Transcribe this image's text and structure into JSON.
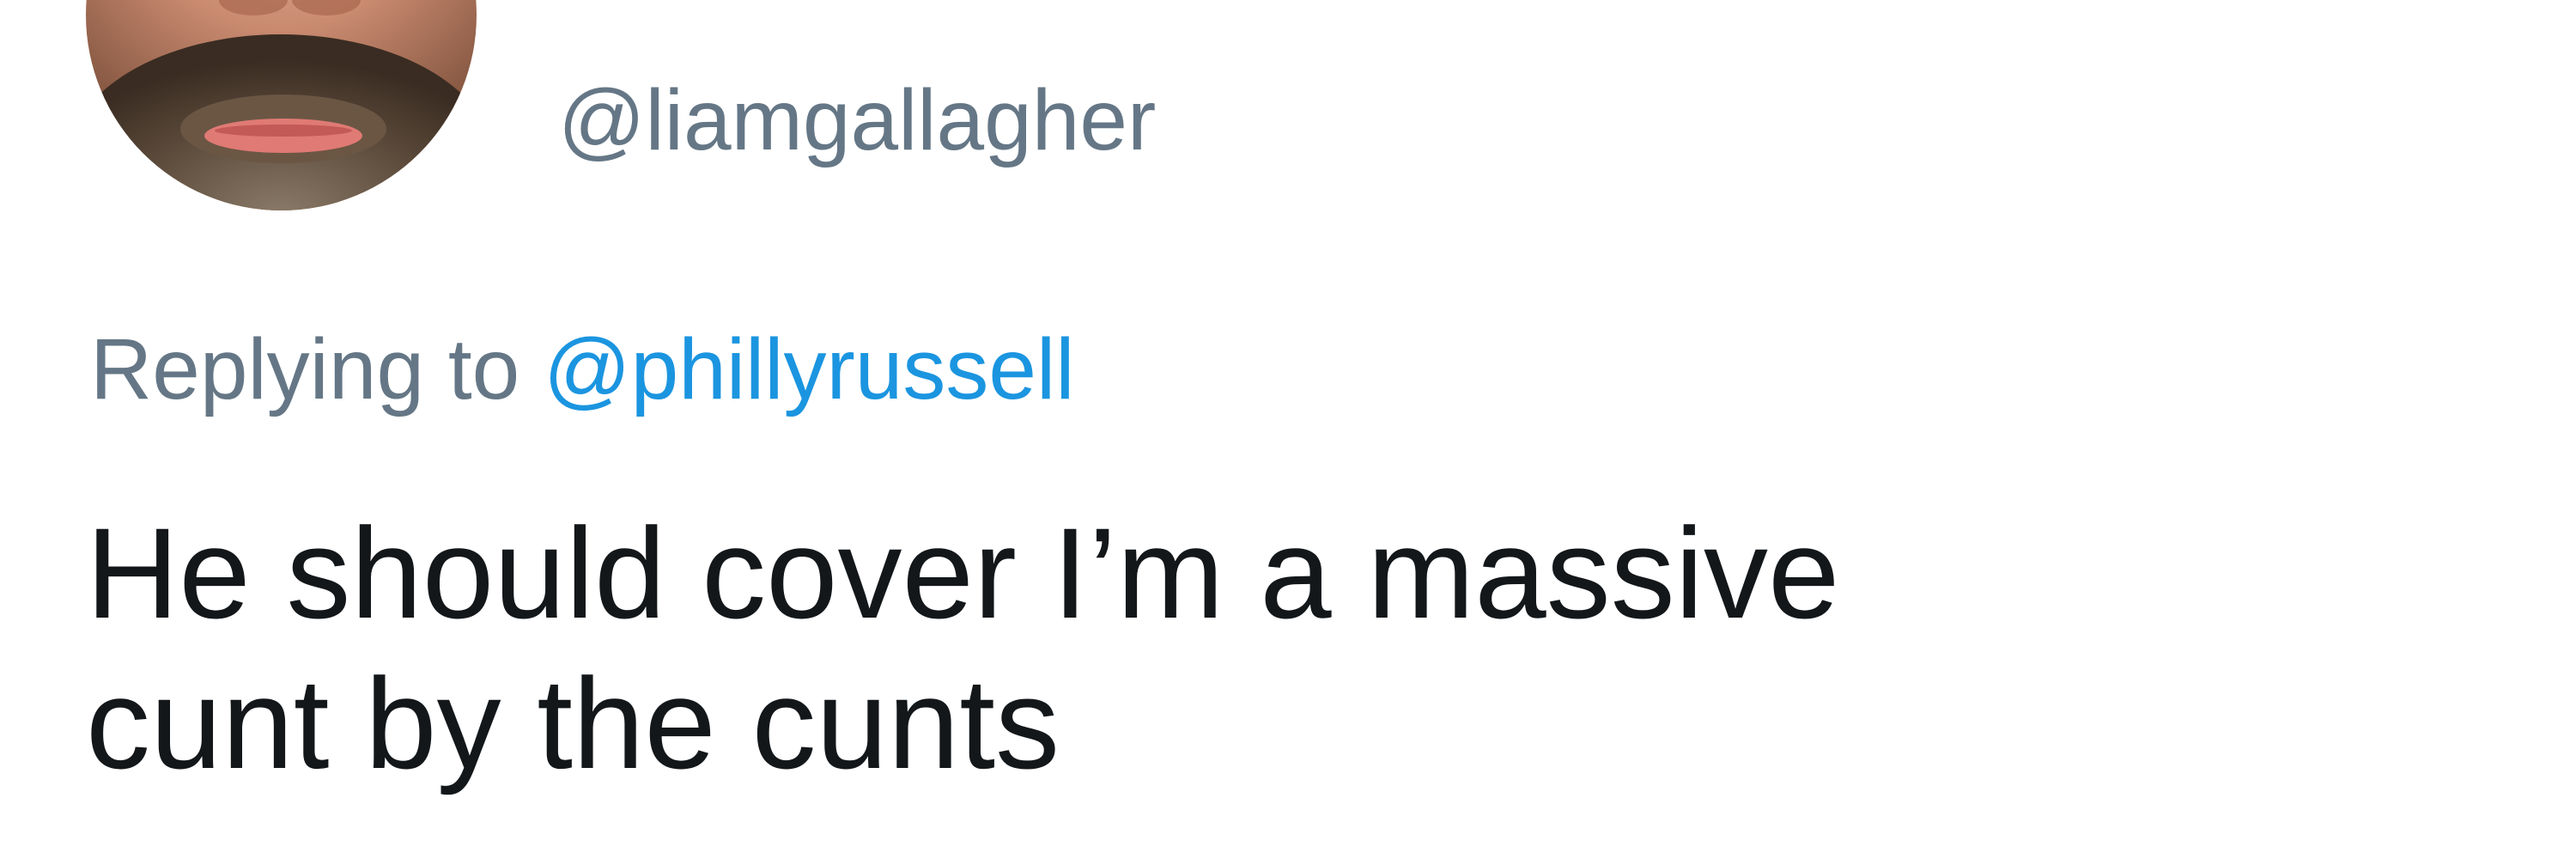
{
  "tweet": {
    "author": {
      "handle": "@liamgallagher",
      "avatar_icon": "profile-photo"
    },
    "reply": {
      "prefix": "Replying to",
      "mention": "@phillyrussell"
    },
    "text_lines": [
      "He should cover I’m a massive",
      "cunt by the cunts"
    ]
  },
  "colors": {
    "secondary_text": "#657786",
    "link": "#1b95e0",
    "primary_text": "#14171a",
    "background": "#ffffff"
  }
}
